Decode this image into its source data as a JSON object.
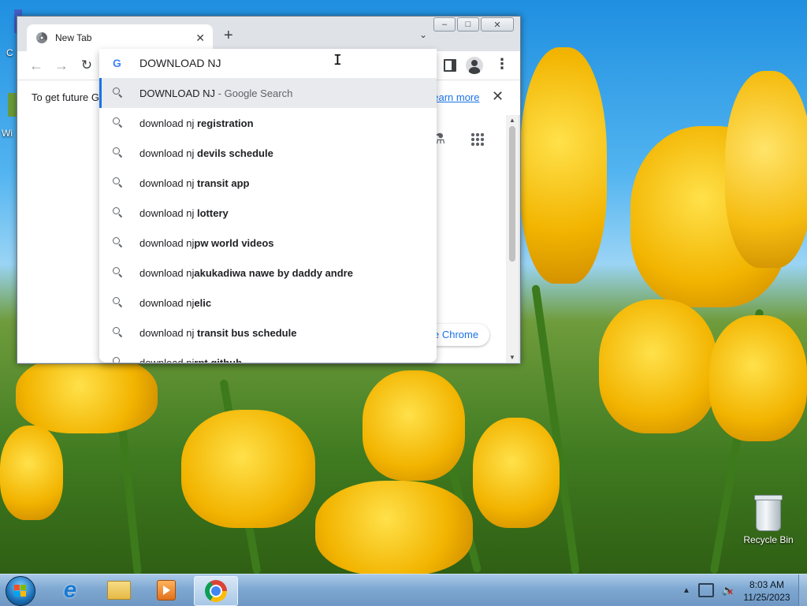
{
  "desktop": {
    "recycle_bin_label": "Recycle Bin"
  },
  "browser": {
    "tab": {
      "title": "New Tab"
    },
    "omnibox": {
      "typed_text": "DOWNLOAD NJ",
      "suggestions": [
        {
          "prefix": "DOWNLOAD NJ",
          "bold": "",
          "suffix": " - Google Search",
          "selected": true
        },
        {
          "prefix": "download nj ",
          "bold": "registration"
        },
        {
          "prefix": "download nj ",
          "bold": "devils schedule"
        },
        {
          "prefix": "download nj ",
          "bold": "transit app"
        },
        {
          "prefix": "download nj ",
          "bold": "lottery"
        },
        {
          "prefix": "download nj",
          "bold": "pw world videos"
        },
        {
          "prefix": "download nj",
          "bold": "akukadiwa nawe by daddy andre"
        },
        {
          "prefix": "download nj",
          "bold": "elic"
        },
        {
          "prefix": "download nj ",
          "bold": "transit bus schedule"
        },
        {
          "prefix": "download nj",
          "bold": "rpt github"
        }
      ]
    },
    "infobar": {
      "message": "To get future G",
      "learn_more": "Learn more"
    },
    "customize_chip": "e Chrome"
  },
  "taskbar": {
    "time": "8:03 AM",
    "date": "11/25/2023"
  },
  "colors": {
    "accent": "#1a73e8",
    "selected_row_bg": "#e8eaed",
    "taskbar": "#7ea8d1"
  }
}
